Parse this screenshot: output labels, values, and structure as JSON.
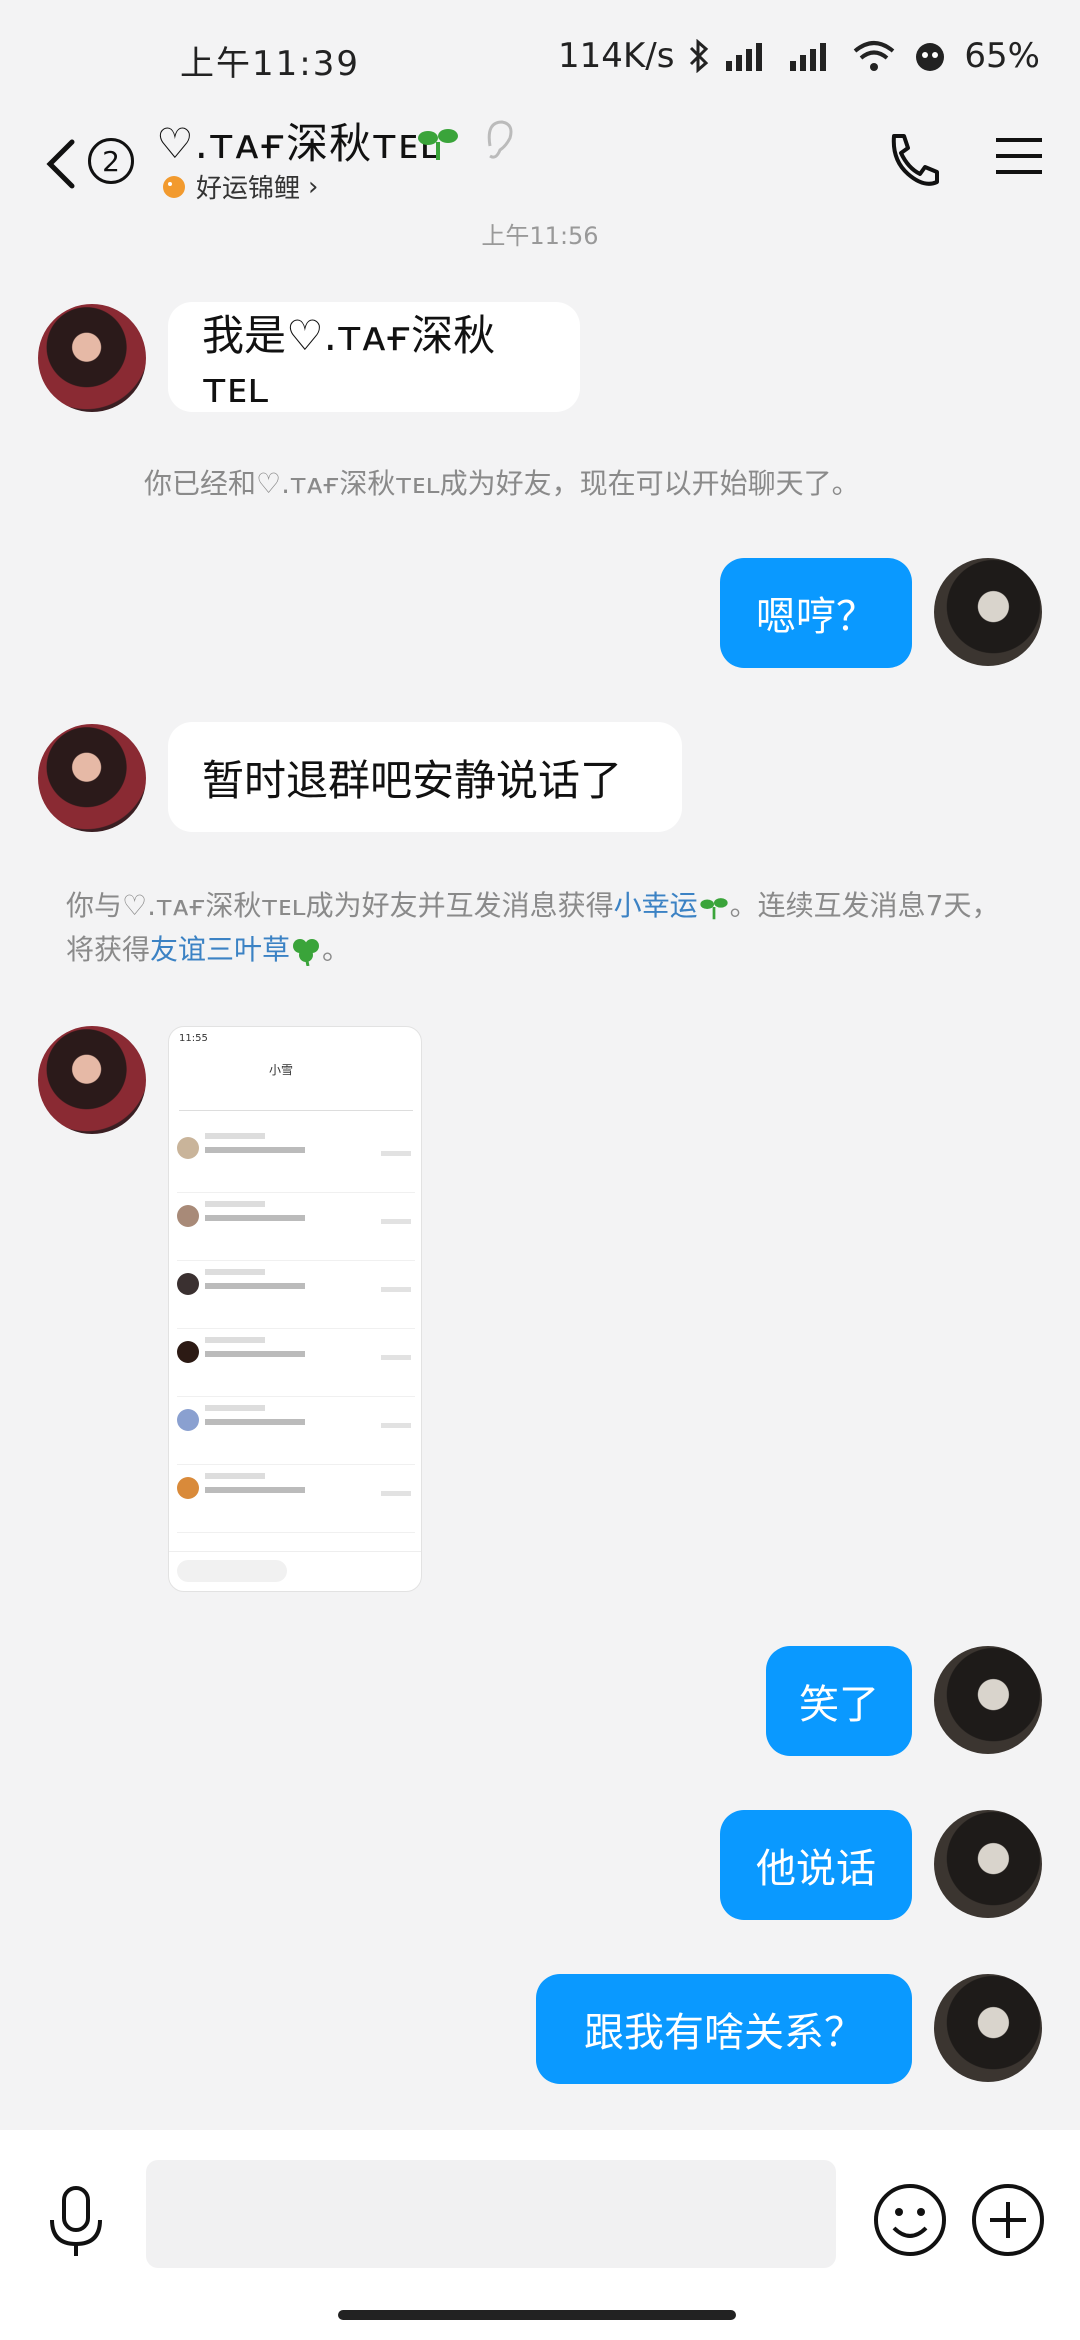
{
  "status_bar": {
    "time": "上午11:39",
    "network_speed": "114K/s",
    "battery": "65%"
  },
  "header": {
    "unread_count": "2",
    "contact_name": "♡.ᴛᴀғ深秋ᴛᴇʟ",
    "status_text": "好运锦鲤",
    "status_arrow": "›"
  },
  "chat": {
    "time_divider": "上午11:56",
    "messages": [
      {
        "from": "them",
        "text": "我是♡.ᴛᴀғ深秋ᴛᴇʟ"
      },
      {
        "type": "system",
        "text": "你已经和♡.ᴛᴀғ深秋ᴛᴇʟ成为好友，现在可以开始聊天了。"
      },
      {
        "from": "me",
        "text": "嗯哼？"
      },
      {
        "from": "them",
        "text": "暂时退群吧安静说话了"
      },
      {
        "type": "system",
        "part1": "你与♡.ᴛᴀғ深秋ᴛᴇʟ成为好友并互发消息获得",
        "link1": "小幸运",
        "part2": "。连续互发消息7天，将获得",
        "link2": "友谊三叶草",
        "part3": "。"
      },
      {
        "from": "them",
        "type": "image"
      },
      {
        "from": "me",
        "text": "笑了"
      },
      {
        "from": "me",
        "text": "他说话"
      },
      {
        "from": "me",
        "text": "跟我有啥关系？"
      }
    ]
  },
  "image_preview": {
    "time": "11:55",
    "title": "小雪"
  },
  "input_bar": {
    "placeholder": ""
  },
  "colors": {
    "outgoing_bubble": "#0a99ff",
    "link": "#3b82c4",
    "background": "#f3f3f4"
  }
}
